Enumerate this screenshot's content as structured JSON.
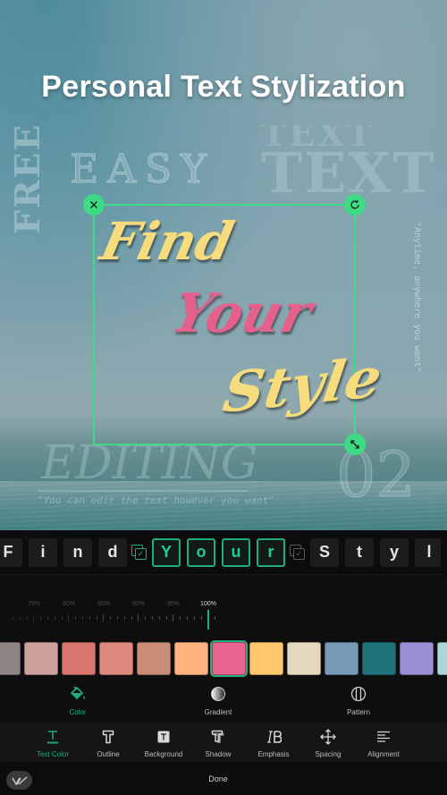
{
  "canvas": {
    "headline": "Personal Text Stylization",
    "background_texts": {
      "free": "FREE",
      "easy": "EASY",
      "text_ghost": "TEXT",
      "text_main": "TEXT",
      "anytime": "\"Anytime, anywhere you want\"",
      "editing": "EDITING",
      "editing_sub": "\"You can edit the text however you want\"",
      "number": "02"
    },
    "selected_text": {
      "line1": "Find",
      "line2": "Your",
      "line3": "Style"
    },
    "handles": {
      "close": "×",
      "rotate": "⟳",
      "resize": "⤡"
    }
  },
  "char_strip": {
    "chars": [
      {
        "ch": "F",
        "active": false
      },
      {
        "ch": "i",
        "active": false
      },
      {
        "ch": "n",
        "active": false
      },
      {
        "ch": "d",
        "active": false
      },
      {
        "group_toggle": "on"
      },
      {
        "ch": "Y",
        "active": true
      },
      {
        "ch": "o",
        "active": true
      },
      {
        "ch": "u",
        "active": true
      },
      {
        "ch": "r",
        "active": true
      },
      {
        "group_toggle": "off"
      },
      {
        "ch": "S",
        "active": false
      },
      {
        "ch": "t",
        "active": false
      },
      {
        "ch": "y",
        "active": false
      },
      {
        "ch": "l",
        "active": false
      }
    ]
  },
  "opacity_ruler": {
    "labels": [
      "75%",
      "80%",
      "85%",
      "90%",
      "95%",
      "100%"
    ],
    "current_value": "100%"
  },
  "swatches": {
    "colors": [
      "#8e8482",
      "#cda29e",
      "#d8756e",
      "#de8980",
      "#c98d76",
      "#ffb37f",
      "#e7648f",
      "#ffc86d",
      "#e4d8be",
      "#7899b5",
      "#1f737b",
      "#9c90d5",
      "#a9d7d8"
    ],
    "selected_index": 6,
    "accent": "#1fae7c"
  },
  "fill_tabs": [
    {
      "label": "Color",
      "icon": "paint-bucket-icon",
      "active": true
    },
    {
      "label": "Gradient",
      "icon": "gradient-icon",
      "active": false
    },
    {
      "label": "Pattern",
      "icon": "pattern-icon",
      "active": false
    }
  ],
  "properties": [
    {
      "label": "Text Color",
      "icon": "text-color-icon",
      "active": true
    },
    {
      "label": "Outline",
      "icon": "outline-icon",
      "active": false
    },
    {
      "label": "Background",
      "icon": "background-icon",
      "active": false
    },
    {
      "label": "Shadow",
      "icon": "shadow-icon",
      "active": false
    },
    {
      "label": "Emphasis",
      "icon": "emphasis-icon",
      "active": false
    },
    {
      "label": "Spacing",
      "icon": "spacing-icon",
      "active": false
    },
    {
      "label": "Alignment",
      "icon": "alignment-icon",
      "active": false
    }
  ],
  "bottom_bar": {
    "done_label": "Done"
  }
}
